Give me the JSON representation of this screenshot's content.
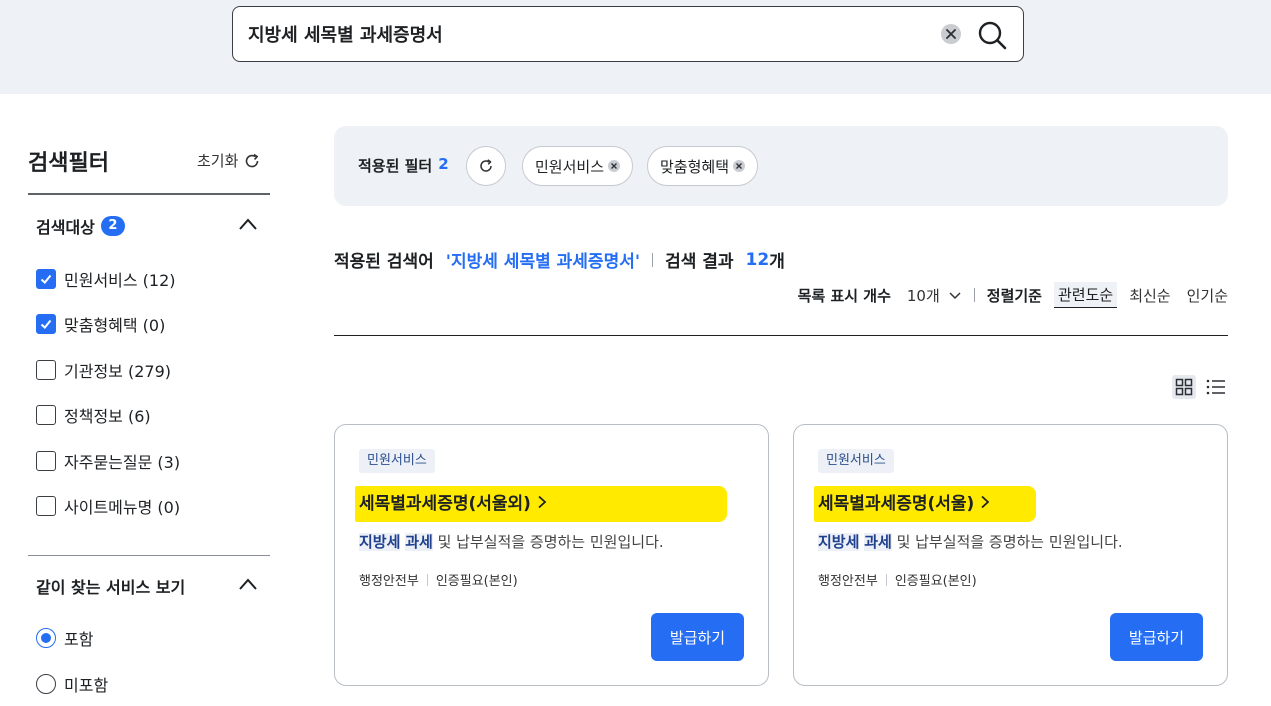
{
  "search": {
    "value": "지방세 세목별 과세증명서"
  },
  "sidebar": {
    "title": "검색필터",
    "reset_label": "초기화",
    "target_group": {
      "title": "검색대상",
      "count": "2",
      "items": [
        {
          "label": "민원서비스 (12)",
          "checked": true
        },
        {
          "label": "맞춤형혜택 (0)",
          "checked": true
        },
        {
          "label": "기관정보 (279)",
          "checked": false
        },
        {
          "label": "정책정보 (6)",
          "checked": false
        },
        {
          "label": "자주묻는질문 (3)",
          "checked": false
        },
        {
          "label": "사이트메뉴명 (0)",
          "checked": false
        }
      ]
    },
    "related_group": {
      "title": "같이 찾는 서비스 보기",
      "options": [
        {
          "label": "포함",
          "selected": true
        },
        {
          "label": "미포함",
          "selected": false
        }
      ]
    }
  },
  "filters": {
    "label": "적용된 필터",
    "count": "2",
    "chips": [
      "민원서비스",
      "맞춤형혜택"
    ]
  },
  "results": {
    "query_prefix": "적용된 검색어",
    "query_value": "'지방세 세목별 과세증명서'",
    "result_label": "검색 결과",
    "result_count": "12",
    "result_unit": "개",
    "page_size_label": "목록 표시 개수",
    "page_size_value": "10개",
    "sort_label": "정렬기준",
    "sort_options": [
      "관련도순",
      "최신순",
      "인기순"
    ],
    "sort_active": "관련도순"
  },
  "cards": [
    {
      "tag": "민원서비스",
      "title": "세목별과세증명(서울외)",
      "desc_kw1": "지방세",
      "desc_kw2": "과세",
      "desc_rest": " 및 납부실적을 증명하는 민원입니다.",
      "org": "행정안전부",
      "auth": "인증필요(본인)",
      "button": "발급하기"
    },
    {
      "tag": "민원서비스",
      "title": "세목별과세증명(서울)",
      "desc_kw1": "지방세",
      "desc_kw2": "과세",
      "desc_rest": " 및 납부실적을 증명하는 민원입니다.",
      "org": "행정안전부",
      "auth": "인증필요(본인)",
      "button": "발급하기"
    }
  ],
  "colors": {
    "accent": "#256ef4",
    "highlight": "#ffea00",
    "band": "#eef1f5"
  }
}
